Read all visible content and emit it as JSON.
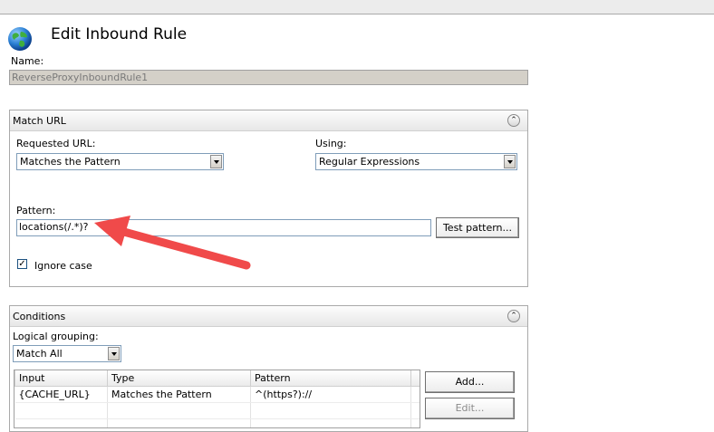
{
  "header": {
    "title": "Edit Inbound Rule",
    "icon": "globe-icon"
  },
  "name": {
    "label": "Name:",
    "value": "ReverseProxyInboundRule1"
  },
  "match_url": {
    "title": "Match URL",
    "requested_url_label": "Requested URL:",
    "requested_url_value": "Matches the Pattern",
    "using_label": "Using:",
    "using_value": "Regular Expressions",
    "pattern_label": "Pattern:",
    "pattern_value": "locations(/.*)?",
    "test_pattern_button": "Test pattern...",
    "ignore_case_label": "Ignore case",
    "ignore_case_checked": true
  },
  "conditions": {
    "title": "Conditions",
    "logical_grouping_label": "Logical grouping:",
    "logical_grouping_value": "Match All",
    "columns": [
      "Input",
      "Type",
      "Pattern"
    ],
    "rows": [
      [
        "{CACHE_URL}",
        "Matches the Pattern",
        "^(https?)://"
      ]
    ],
    "add_button": "Add...",
    "edit_button": "Edit..."
  },
  "colors": {
    "annotation_arrow": "#f04a4a",
    "group_border": "#a9a9a9",
    "input_border": "#7f9db9"
  }
}
